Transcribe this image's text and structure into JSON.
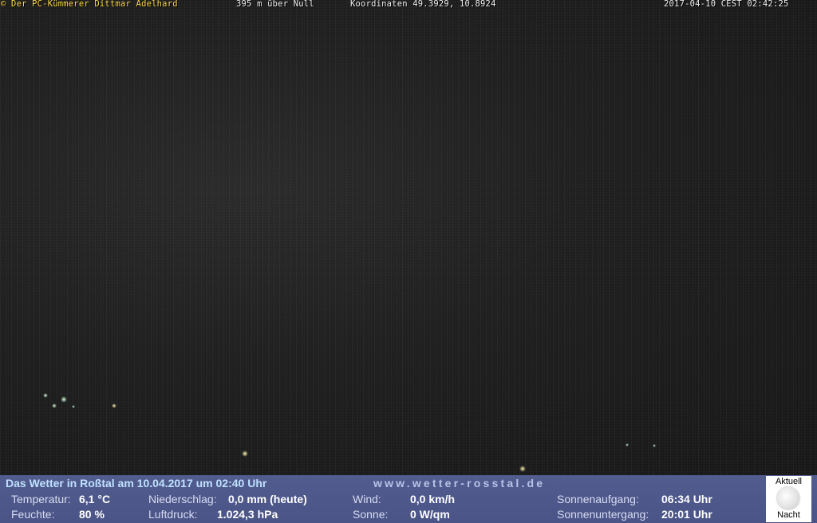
{
  "overlay": {
    "credit": "© Der PC-Kümmerer Dittmar Adelhard",
    "altitude": "395 m über Null",
    "coordinates": "Koordinaten 49.3929, 10.8924",
    "timestamp": "2017-04-10 CEST 02:42:25"
  },
  "panel": {
    "headline": "Das Wetter in Roßtal am 10.04.2017 um 02:40 Uhr",
    "website": "www.wetter-rosstal.de",
    "temperature_label": "Temperatur:",
    "temperature_value": "6,1 °C",
    "humidity_label": "Feuchte:",
    "humidity_value": "80 %",
    "precip_label": "Niederschlag:",
    "precip_value": "0,0 mm (heute)",
    "pressure_label": "Luftdruck:",
    "pressure_value": "1.024,3 hPa",
    "wind_label": "Wind:",
    "wind_value": "0,0 km/h",
    "sun_label": "Sonne:",
    "sun_value": "0 W/qm",
    "sunrise_label": "Sonnenaufgang:",
    "sunrise_value": "06:34 Uhr",
    "sunset_label": "Sonnenuntergang:",
    "sunset_value": "20:01 Uhr",
    "moon_top": "Aktuell",
    "moon_bottom": "Nacht"
  },
  "colors": {
    "panel_bg": "#4e5889",
    "headline": "#bfe1ff",
    "credit": "#ffd84a"
  }
}
